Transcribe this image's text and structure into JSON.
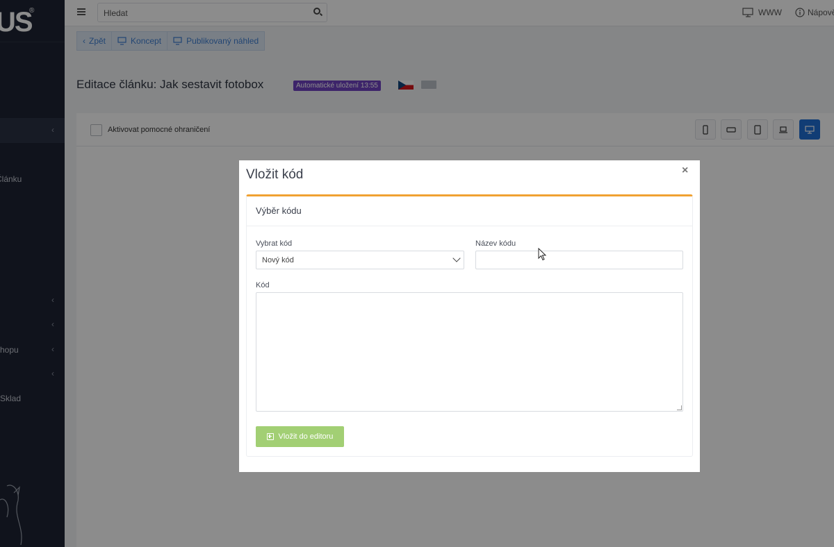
{
  "sidebar": {
    "logo": "US",
    "logo_reg": "®",
    "items": [
      {
        "label": "Článku"
      },
      {
        "label": "hopu"
      },
      {
        "label": "Sklad"
      }
    ],
    "chevron": "‹"
  },
  "topbar": {
    "search_placeholder": "Hledat",
    "www": "WWW",
    "help": "Nápově"
  },
  "toolbar": {
    "back": "Zpět",
    "draft": "Koncept",
    "published_preview": "Publikovaný náhled"
  },
  "page": {
    "title": "Editace článku:  Jak sestavit fotobox",
    "autosave": "Automatické uložení 13:55"
  },
  "editor": {
    "helper_bounds": "Aktivovat pomocné ohraničení",
    "devices": [
      "mobile-portrait",
      "mobile-landscape",
      "tablet",
      "laptop",
      "desktop"
    ],
    "active_device": "desktop"
  },
  "modal": {
    "title": "Vložit kód",
    "close": "×",
    "card_title": "Výběr kódu",
    "select_label": "Vybrat kód",
    "select_value": "Nový kód",
    "name_label": "Název kódu",
    "name_value": "",
    "code_label": "Kód",
    "code_value": "",
    "insert_button": "Vložit do editoru"
  },
  "colors": {
    "sidebar_bg": "#1e2433",
    "accent_blue": "#1f6fd6",
    "card_border_top": "#f0a132",
    "badge_purple": "#6f42c1",
    "button_green": "#a2cf74"
  }
}
